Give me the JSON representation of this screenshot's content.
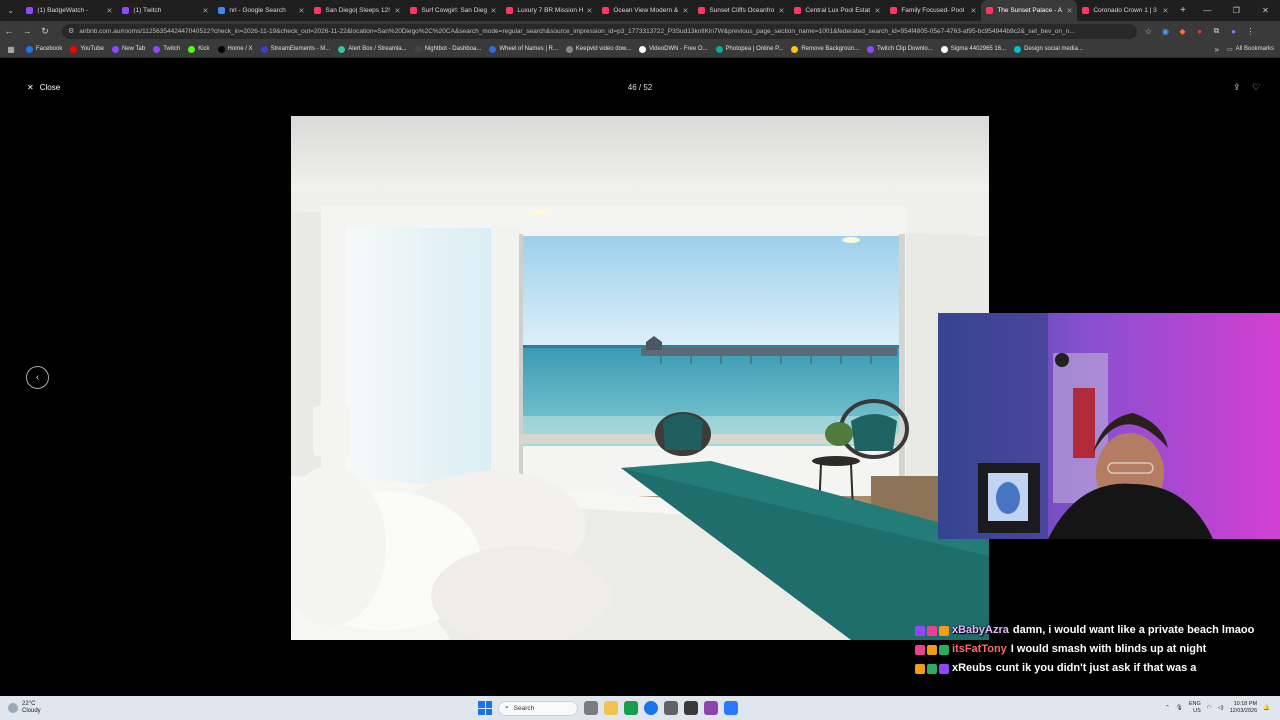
{
  "browser": {
    "tabs": [
      {
        "label": "(1) BadgeWatch - ",
        "color": "#9146ff"
      },
      {
        "label": "(1) Twitch",
        "color": "#9146ff"
      },
      {
        "label": "nrl - Google Search",
        "color": "#4285f4"
      },
      {
        "label": "San Diego| Sleeps 12!",
        "color": "#ff385c"
      },
      {
        "label": "Surf Cowgirl: San Dieg",
        "color": "#ff385c"
      },
      {
        "label": "Luxury 7 BR Mission H",
        "color": "#ff385c"
      },
      {
        "label": "Ocean View Modern &",
        "color": "#ff385c"
      },
      {
        "label": "Sunset Cliffs Oceanfro",
        "color": "#ff385c"
      },
      {
        "label": "Central Lux Pool Estat",
        "color": "#ff385c"
      },
      {
        "label": "Family Focused- Pool",
        "color": "#ff385c"
      },
      {
        "label": "The Sunset Palace - A",
        "color": "#ff385c",
        "active": true
      },
      {
        "label": "Coronado Crown 1 | 3",
        "color": "#ff385c"
      }
    ],
    "url": "airbnb.com.au/rooms/1125635442447040512?check_in=2026-11-19&check_out=2026-11-22&location=San%20Diego%2C%20CA&search_mode=regular_search&source_impression_id=p3_1773313722_P3Sud13knlIKln7W&previous_page_section_name=1001&federated_search_id=954f4805-05e7-4763-af95-bc954944b9c2&_set_bev_on_n...",
    "bookmarks": [
      {
        "label": "Facebook",
        "color": "#1877f2"
      },
      {
        "label": "YouTube",
        "color": "#ff0000"
      },
      {
        "label": "New Tab",
        "color": "#9146ff"
      },
      {
        "label": "Twitch",
        "color": "#9146ff"
      },
      {
        "label": "Kick",
        "color": "#53fc18"
      },
      {
        "label": "Home / X",
        "color": "#000000"
      },
      {
        "label": "StreamElements - M...",
        "color": "#3b3bd6"
      },
      {
        "label": "Alert Box / Streamla...",
        "color": "#31c3a2"
      },
      {
        "label": "Nightbot - Dashboa...",
        "color": "#444444"
      },
      {
        "label": "Wheel of Names | R...",
        "color": "#3369e8"
      },
      {
        "label": "Keepvid video dow...",
        "color": "#888888"
      },
      {
        "label": "VideoDWN - Free O...",
        "color": "#ffffff"
      },
      {
        "label": "Photopea | Online P...",
        "color": "#18a497"
      },
      {
        "label": "Remove Backgroun...",
        "color": "#f5c518"
      },
      {
        "label": "Twitch Clip Downlo...",
        "color": "#9146ff"
      },
      {
        "label": "Sigma 4402965 16...",
        "color": "#ffffff"
      },
      {
        "label": "Design social media...",
        "color": "#00c4cc"
      }
    ],
    "all_bookmarks": "All Bookmarks"
  },
  "viewer": {
    "close_label": "Close",
    "counter": "46 / 52"
  },
  "chat": [
    {
      "user": "xBabyAzra",
      "color": "#e6b3ff",
      "message": "damn, i would want like a private beach lmaoo"
    },
    {
      "user": "itsFatTony",
      "color": "#ff6b6b",
      "message": "I would smash with blinds up at night"
    },
    {
      "user": "xReubs",
      "color": "#ffffff",
      "message": "cunt ik you didn't just ask if that was a"
    }
  ],
  "taskbar": {
    "weather_temp": "22°C",
    "weather_desc": "Cloudy",
    "search_label": "Search",
    "lang_top": "ENG",
    "lang_bottom": "US",
    "time": "10:18 PM",
    "date": "12/03/2026"
  }
}
